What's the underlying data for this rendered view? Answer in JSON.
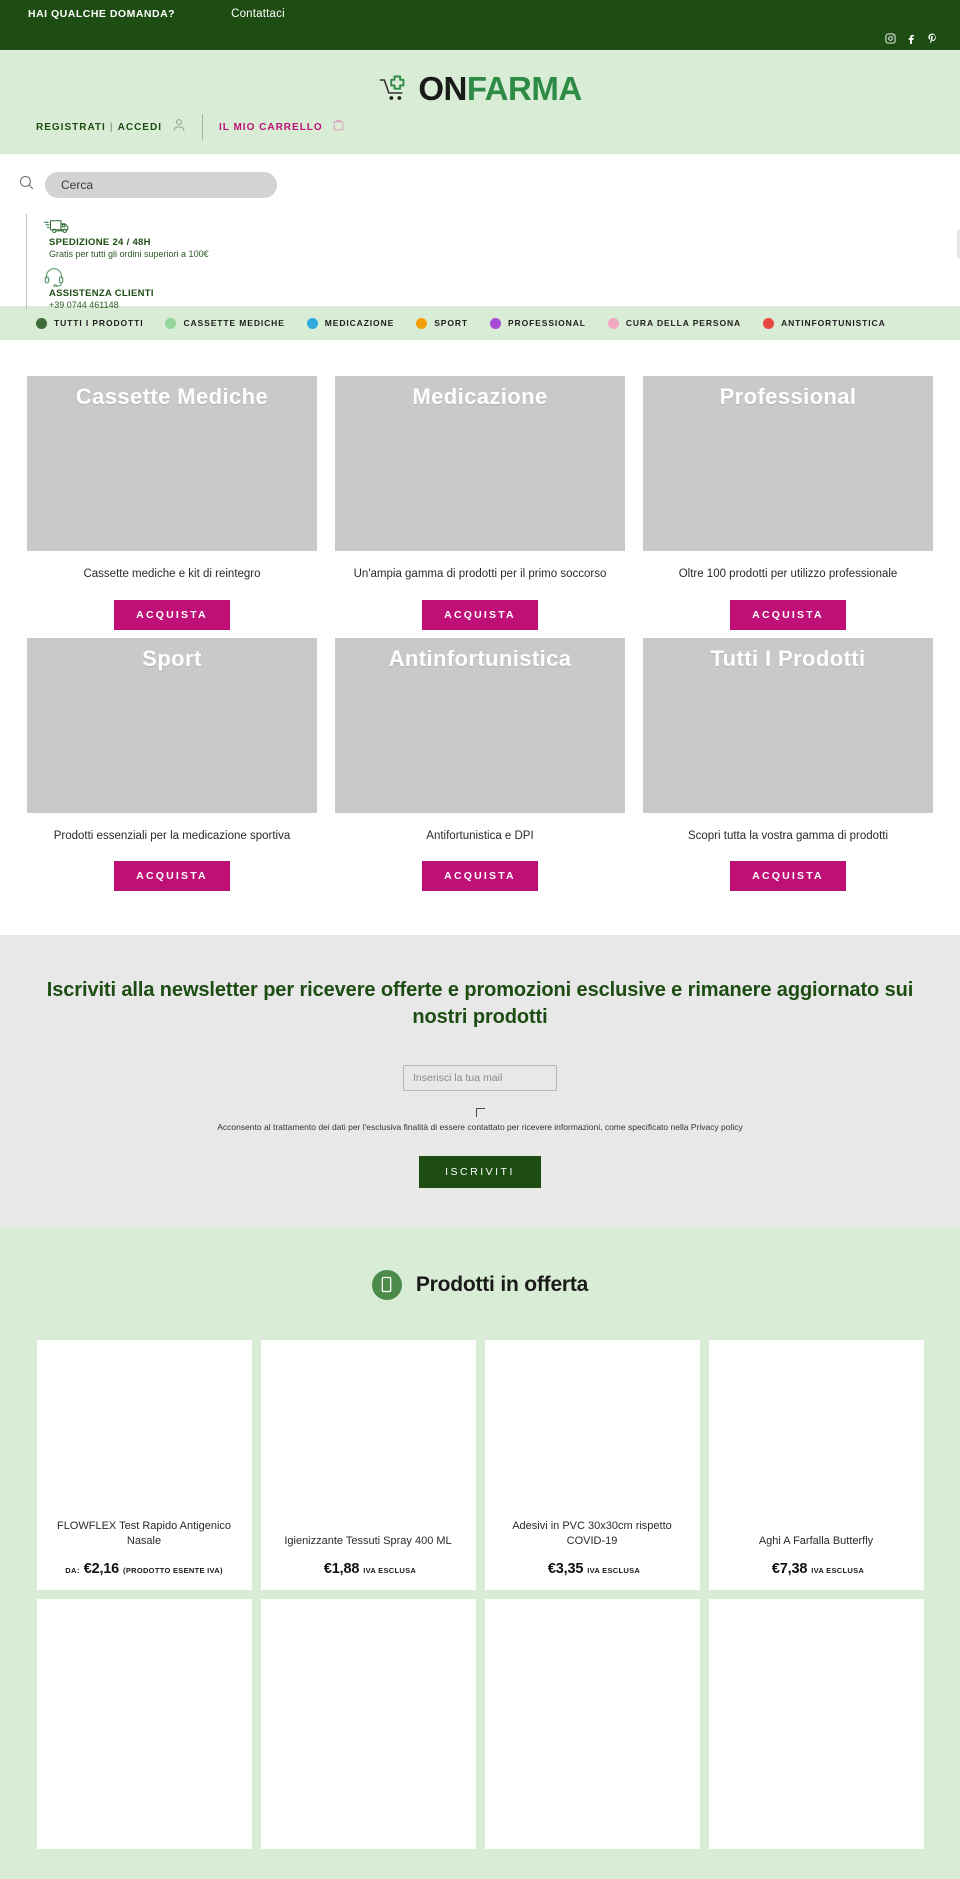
{
  "topbar": {
    "question_label": "HAI QUALCHE DOMANDA?",
    "contact_label": "Contattaci",
    "social": [
      {
        "name": "instagram-icon",
        "glyph": "instagram"
      },
      {
        "name": "facebook-icon",
        "glyph": "facebook"
      },
      {
        "name": "pinterest-icon",
        "glyph": "pinterest"
      }
    ]
  },
  "logo": {
    "part_one": "ON",
    "part_two": "FARMA",
    "mark": "cart-medical-cross-icon"
  },
  "account": {
    "register_label": "REGISTRATI",
    "separator": "|",
    "login_label": "ACCEDI",
    "user_icon": "user-icon",
    "cart_label": "IL MIO CARRELLO",
    "cart_icon": "bag-icon"
  },
  "search": {
    "icon": "search-icon",
    "placeholder": "Cerca",
    "value": ""
  },
  "info": [
    {
      "icon": "truck-icon",
      "title": "SPEDIZIONE 24 / 48H",
      "subtitle": "Gratis per tutti gli ordini superiori a 100€"
    },
    {
      "icon": "headset-icon",
      "title": "ASSISTENZA CLIENTI",
      "subtitle": "+39 0744 461148"
    }
  ],
  "categories": [
    {
      "label": "TUTTI I PRODOTTI",
      "color": "#3e6b3a"
    },
    {
      "label": "CASSETTE MEDICHE",
      "color": "#94d79a"
    },
    {
      "label": "MEDICAZIONE",
      "color": "#32aade"
    },
    {
      "label": "SPORT",
      "color": "#f2a007"
    },
    {
      "label": "PROFESSIONAL",
      "color": "#a64ad4"
    },
    {
      "label": "CURA DELLA PERSONA",
      "color": "#f2a8c0"
    },
    {
      "label": "ANTINFORTUNISTICA",
      "color": "#e8483f"
    }
  ],
  "category_cards": [
    {
      "title": "Cassette Mediche",
      "desc": "Cassette mediche e kit di reintegro",
      "button": "ACQUISTA"
    },
    {
      "title": "Medicazione",
      "desc": "Un'ampia gamma di prodotti per il primo soccorso",
      "button": "ACQUISTA"
    },
    {
      "title": "Professional",
      "desc": "Oltre 100 prodotti per utilizzo professionale",
      "button": "ACQUISTA"
    },
    {
      "title": "Sport",
      "desc": "Prodotti essenziali per la medicazione sportiva",
      "button": "ACQUISTA"
    },
    {
      "title": "Antinfortunistica",
      "desc": "Antifortunistica e DPI",
      "button": "ACQUISTA"
    },
    {
      "title": "Tutti I Prodotti",
      "desc": "Scopri tutta la vostra gamma di prodotti",
      "button": "ACQUISTA"
    }
  ],
  "newsletter": {
    "title": "Iscriviti alla newsletter per ricevere offerte e promozioni esclusive e rimanere aggiornato sui nostri prodotti",
    "email_placeholder": "Inserisci la tua mail",
    "email_value": "",
    "consent": "Acconsento al trattamento dei dati per l'esclusiva finalità di essere contattato per ricevere informazioni, come specificato nella Privacy policy",
    "consent_checked": false,
    "submit_label": "ISCRIVITI"
  },
  "offers": {
    "badge_icon": "tag-icon",
    "title": "Prodotti in offerta",
    "products": [
      {
        "name": "FLOWFLEX Test Rapido Antigenico Nasale",
        "prefix": "DA:",
        "amount": "€2,16",
        "note": "(PRODOTTO ESENTE IVA)"
      },
      {
        "name": "Igienizzante Tessuti Spray 400 ML",
        "prefix": "",
        "amount": "€1,88",
        "note": "IVA ESCLUSA"
      },
      {
        "name": "Adesivi in PVC 30x30cm rispetto COVID-19",
        "prefix": "",
        "amount": "€3,35",
        "note": "IVA ESCLUSA"
      },
      {
        "name": "Aghi A Farfalla Butterfly",
        "prefix": "",
        "amount": "€7,38",
        "note": "IVA ESCLUSA"
      },
      {
        "name": "",
        "prefix": "",
        "amount": "",
        "note": ""
      },
      {
        "name": "",
        "prefix": "",
        "amount": "",
        "note": ""
      },
      {
        "name": "",
        "prefix": "",
        "amount": "",
        "note": ""
      },
      {
        "name": "",
        "prefix": "",
        "amount": "",
        "note": ""
      }
    ]
  },
  "colors": {
    "dark_green": "#1d4d13",
    "light_green": "#d9ecd5",
    "magenta": "#bf1077",
    "logo_green": "#2e8b45"
  }
}
